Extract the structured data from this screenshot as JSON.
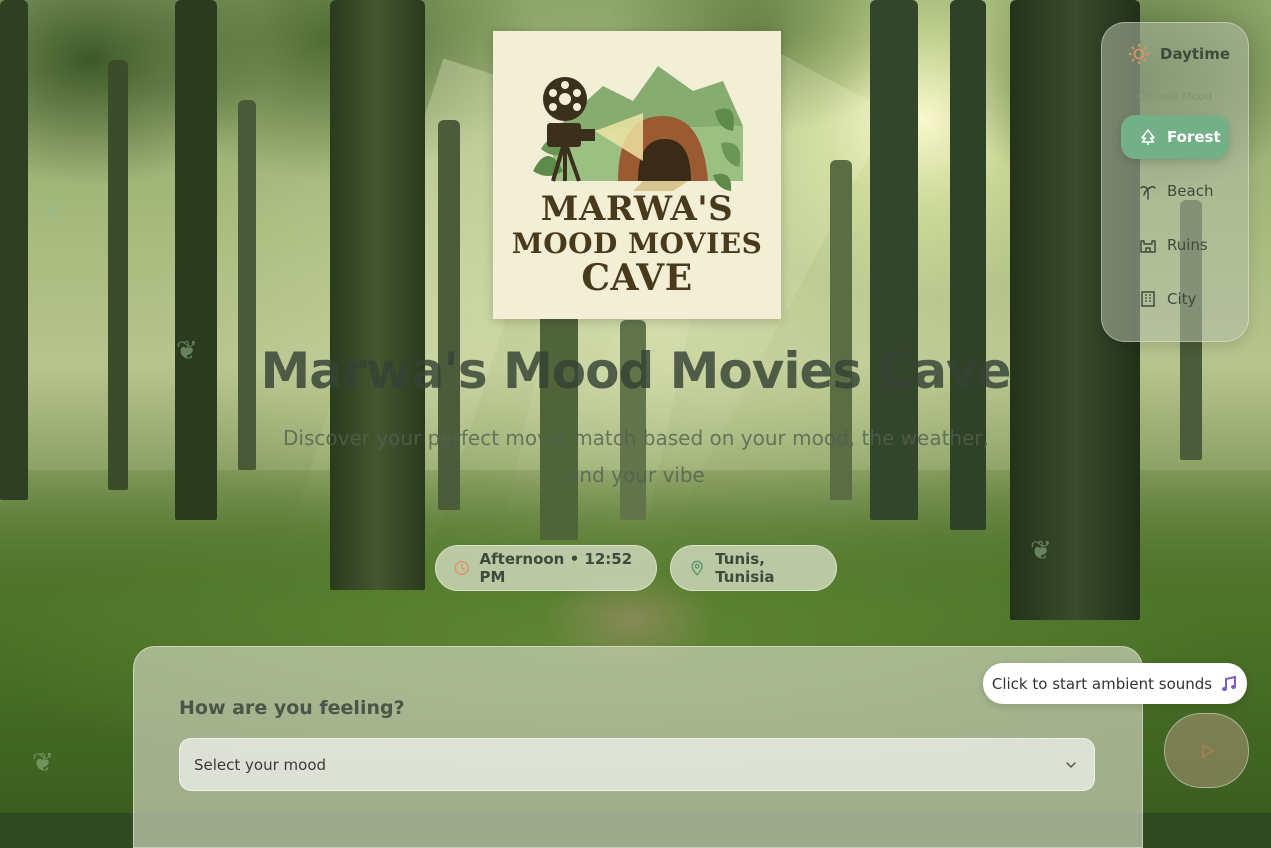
{
  "logo": {
    "line1": "MARWA'S",
    "line2": "MOOD MOVIES",
    "line3": "CAVE"
  },
  "hero": {
    "title": "Marwa's Mood Movies Cave",
    "subtitle": "Discover your perfect movie match based on your mood, the weather, and your vibe"
  },
  "status": {
    "time_label": "Afternoon • 12:52 PM",
    "location_label": "Tunis, Tunisia"
  },
  "side_panel": {
    "daytime_label": "Daytime",
    "choose_label": "Choose Mood",
    "items": [
      {
        "label": "Forest",
        "icon": "tree-icon",
        "active": true
      },
      {
        "label": "Beach",
        "icon": "palm-icon",
        "active": false
      },
      {
        "label": "Ruins",
        "icon": "castle-icon",
        "active": false
      },
      {
        "label": "City",
        "icon": "building-icon",
        "active": false
      }
    ]
  },
  "mood_form": {
    "question": "How are you feeling?",
    "select_placeholder": "Select your mood"
  },
  "ambient": {
    "tooltip": "Click to start ambient sounds"
  },
  "colors": {
    "active_mood": "#73b088",
    "title": "#344234"
  }
}
